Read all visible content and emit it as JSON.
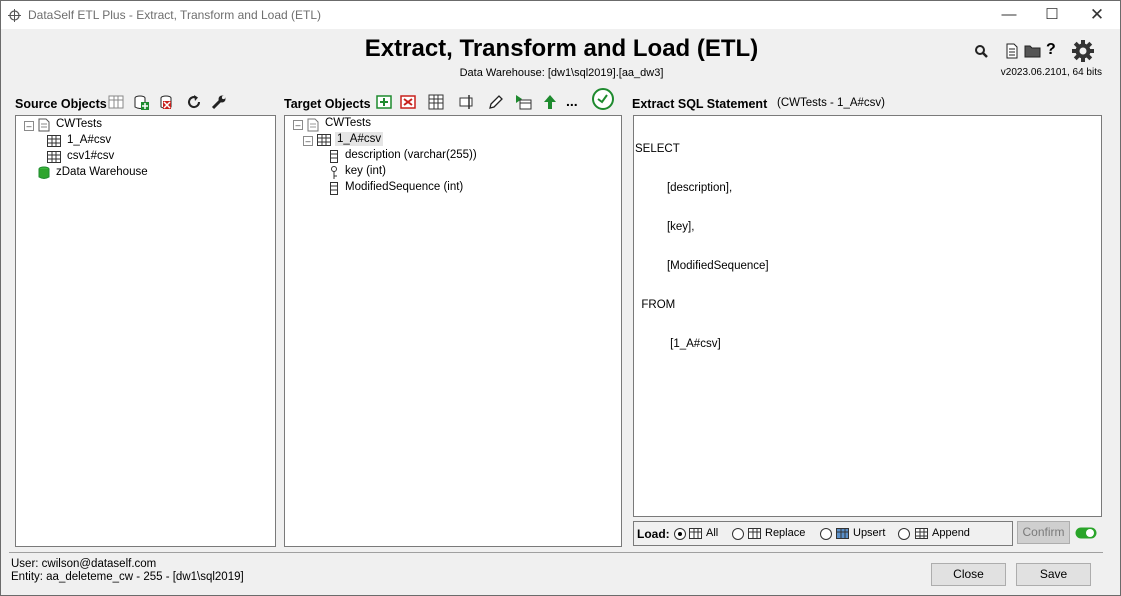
{
  "window": {
    "title": "DataSelf ETL Plus - Extract, Transform and Load (ETL)"
  },
  "header": {
    "title": "Extract, Transform and Load (ETL)",
    "subtitle": "Data Warehouse: [dw1\\sql2019].[aa_dw3]",
    "version": "v2023.06.2101, 64 bits"
  },
  "source": {
    "title": "Source Objects",
    "tree": {
      "root": "CWTests",
      "children": [
        "1_A#csv",
        "csv1#csv"
      ],
      "warehouse": "zData Warehouse"
    }
  },
  "target": {
    "title": "Target Objects",
    "more_label": "...",
    "tree": {
      "root": "CWTests",
      "table": "1_A#csv",
      "columns": [
        "description (varchar(255))",
        "key (int)",
        "ModifiedSequence (int)"
      ]
    }
  },
  "sql": {
    "title": "Extract SQL Statement",
    "context": "(CWTests - 1_A#csv)",
    "lines": [
      "SELECT",
      "          [description],",
      "          [key],",
      "          [ModifiedSequence]",
      "  FROM",
      "           [1_A#csv]"
    ]
  },
  "load": {
    "label": "Load:",
    "options": [
      "All",
      "Replace",
      "Upsert",
      "Append"
    ],
    "selected": "All",
    "confirm": "Confirm"
  },
  "footer": {
    "user": "User:  cwilson@dataself.com",
    "entity": "Entity: aa_deleteme_cw - 255 -  [dw1\\sql2019]",
    "close": "Close",
    "save": "Save"
  },
  "colors": {
    "green": "#1e8a2e",
    "red": "#c8201c",
    "toggle": "#2aa52a"
  }
}
